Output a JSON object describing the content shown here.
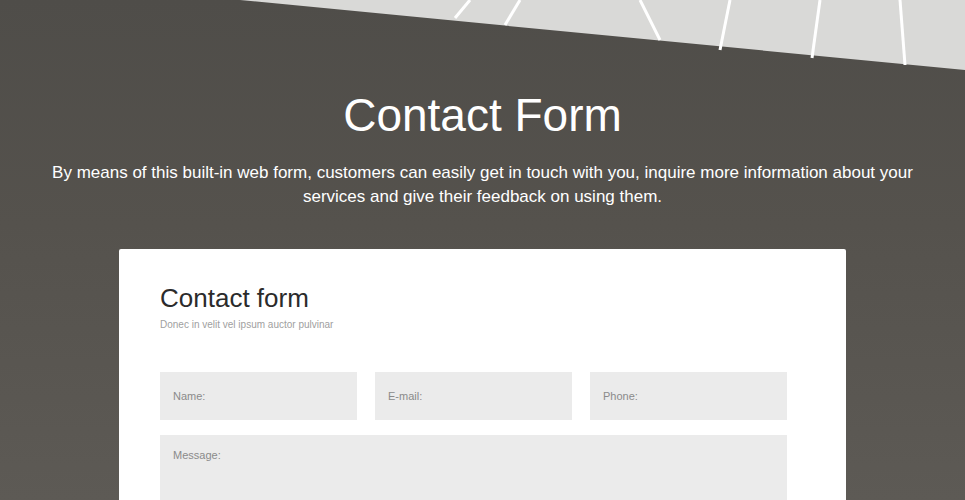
{
  "section": {
    "title": "Contact Form",
    "description": "By means of this built-in web form, customers can easily get in touch with you, inquire more information about your services and give their feedback on using them."
  },
  "form": {
    "title": "Contact form",
    "subtitle": "Donec in velit vel ipsum auctor pulvinar",
    "fields": [
      {
        "placeholder": "Name:"
      },
      {
        "placeholder": "E-mail:"
      },
      {
        "placeholder": "Phone:"
      }
    ],
    "message": {
      "placeholder": "Message:"
    }
  }
}
